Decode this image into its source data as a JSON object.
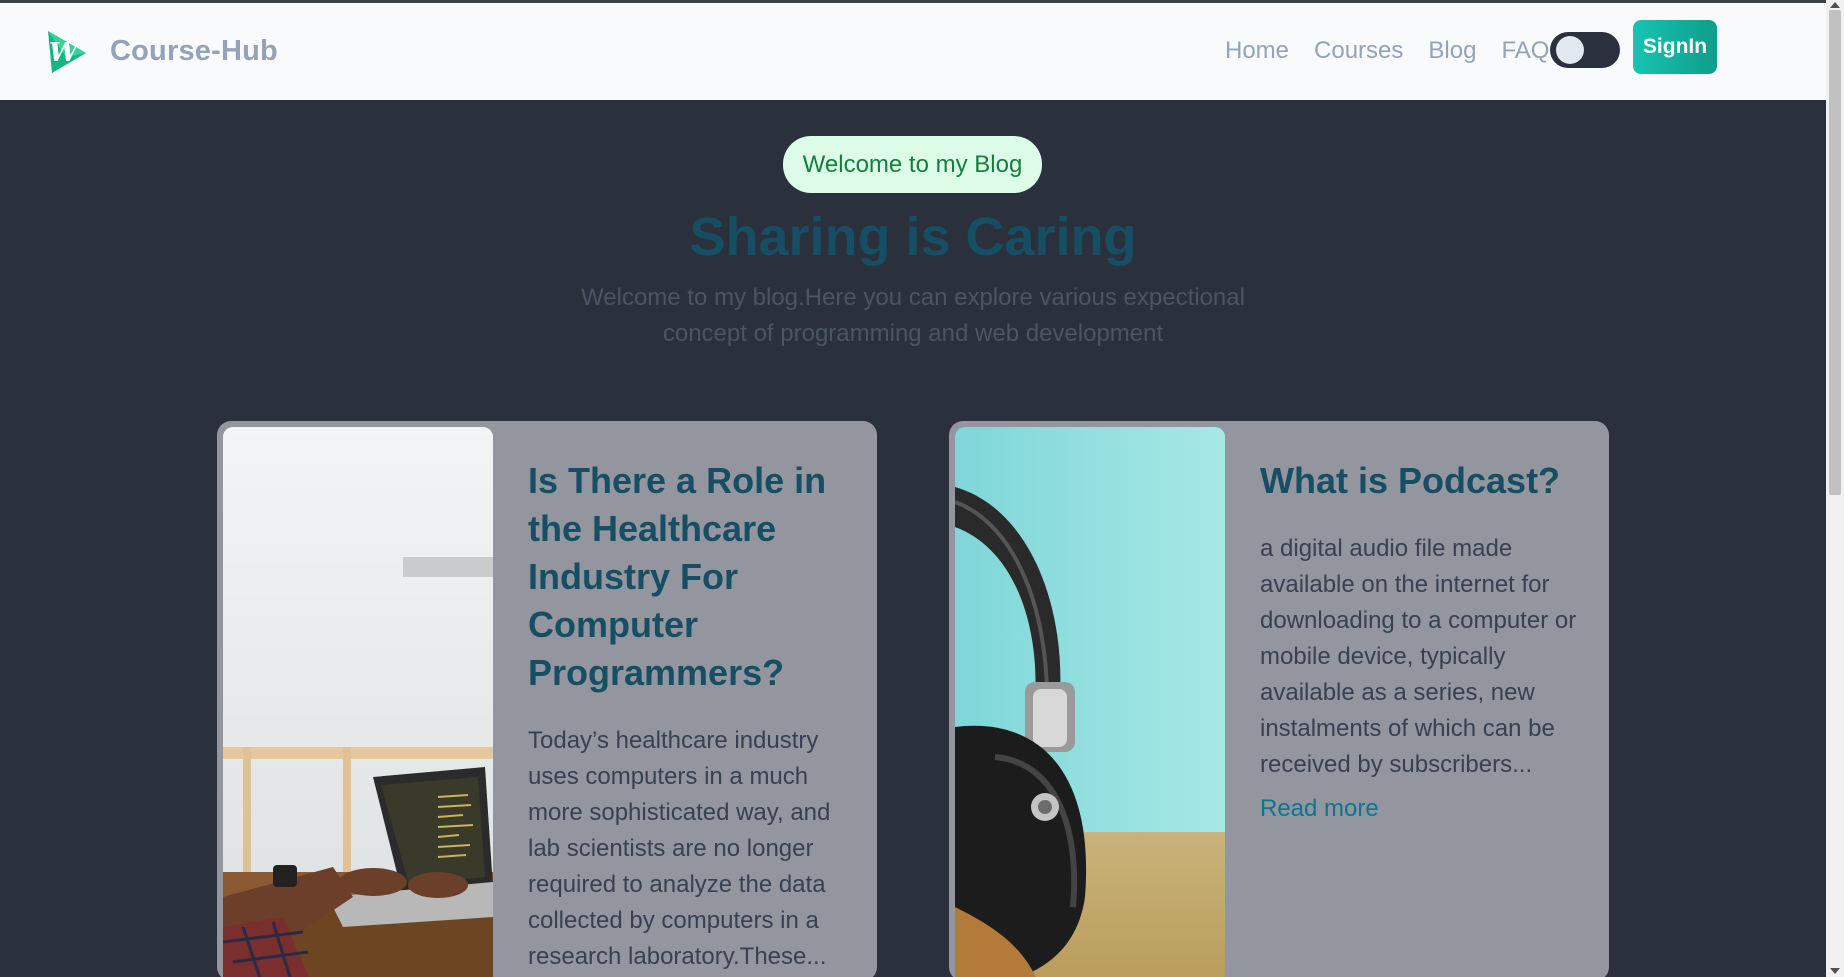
{
  "navbar": {
    "brand": "Course-Hub",
    "links": [
      "Home",
      "Courses",
      "Blog",
      "FAQ"
    ],
    "signin_label": "SignIn"
  },
  "hero": {
    "badge": "Welcome to my Blog",
    "title": "Sharing is Caring",
    "subtitle": "Welcome to my blog.Here you can explore various expectional concept of programming and web development"
  },
  "posts": [
    {
      "title": "Is There a Role in the Healthcare Industry For Computer Programmers?",
      "excerpt": "Today’s healthcare industry uses computers in a much more sophisticated way, and lab scientists are no longer required to analyze the data collected by computers in a research laboratory.These..."
    },
    {
      "title": "What is Podcast?",
      "excerpt": "a digital audio file made available on the internet for downloading to a computer or mobile device, typically available as a series, new instalments of which can be received by subscribers...",
      "read_more": "Read more"
    }
  ],
  "colors": {
    "page_bg": "#2a303c",
    "navbar_bg": "#f8fafc",
    "accent": "#17c3b2",
    "card_bg": "#94969f",
    "title_color": "#164e63"
  },
  "icons": {
    "logo": "course-hub-logo-icon",
    "theme_toggle": "theme-toggle"
  }
}
